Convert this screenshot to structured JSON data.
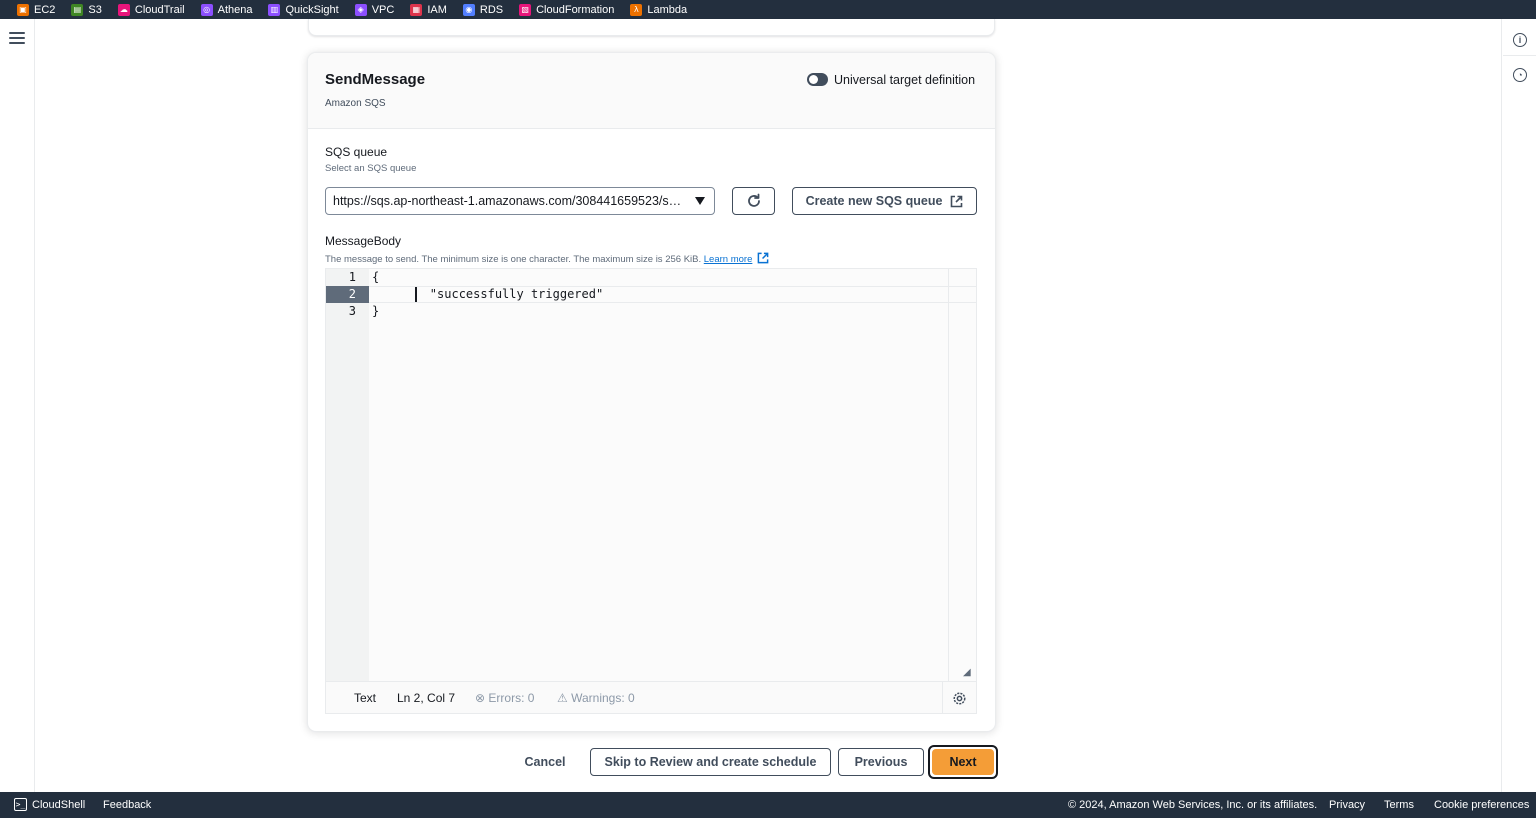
{
  "favorites": [
    {
      "label": "EC2",
      "color": "#ed7100",
      "glyph": "▣",
      "icon": "ec2-icon"
    },
    {
      "label": "S3",
      "color": "#3f8624",
      "glyph": "▤",
      "icon": "s3-icon"
    },
    {
      "label": "CloudTrail",
      "color": "#e7157b",
      "glyph": "☁",
      "icon": "cloudtrail-icon"
    },
    {
      "label": "Athena",
      "color": "#8c4fff",
      "glyph": "◎",
      "icon": "athena-icon"
    },
    {
      "label": "QuickSight",
      "color": "#8c4fff",
      "glyph": "▥",
      "icon": "quicksight-icon"
    },
    {
      "label": "VPC",
      "color": "#8c4fff",
      "glyph": "◈",
      "icon": "vpc-icon"
    },
    {
      "label": "IAM",
      "color": "#dd344c",
      "glyph": "▦",
      "icon": "iam-icon"
    },
    {
      "label": "RDS",
      "color": "#527fff",
      "glyph": "◉",
      "icon": "rds-icon"
    },
    {
      "label": "CloudFormation",
      "color": "#e7157b",
      "glyph": "▧",
      "icon": "cloudformation-icon"
    },
    {
      "label": "Lambda",
      "color": "#ed7100",
      "glyph": "λ",
      "icon": "lambda-icon"
    }
  ],
  "target": {
    "title": "SendMessage",
    "service": "Amazon SQS",
    "universal_toggle_label": "Universal target definition"
  },
  "sqs_queue": {
    "label": "SQS queue",
    "description": "Select an SQS queue",
    "selected_value": "https://sqs.ap-northeast-1.amazonaws.com/308441659523/s…",
    "create_button": "Create new SQS queue"
  },
  "message_body": {
    "label": "MessageBody",
    "description": "The message to send. The minimum size is one character. The maximum size is 256 KiB.",
    "learn_more": "Learn more",
    "lines": [
      {
        "number": "1",
        "text": "{"
      },
      {
        "number": "2",
        "text": "        \"successfully triggered\""
      },
      {
        "number": "3",
        "text": "}"
      }
    ],
    "status": {
      "mode": "Text",
      "position": "Ln 2, Col 7",
      "errors": "Errors: 0",
      "warnings": "Warnings: 0"
    }
  },
  "actions": {
    "cancel": "Cancel",
    "skip": "Skip to Review and create schedule",
    "previous": "Previous",
    "next": "Next"
  },
  "footer": {
    "cloudshell": "CloudShell",
    "feedback": "Feedback",
    "copyright": "© 2024, Amazon Web Services, Inc. or its affiliates.",
    "privacy": "Privacy",
    "terms": "Terms",
    "cookie": "Cookie preferences"
  }
}
